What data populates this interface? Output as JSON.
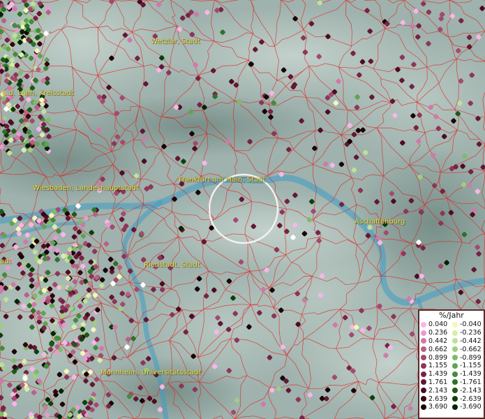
{
  "map": {
    "cities": [
      {
        "id": "wetzlar",
        "name": "Wetzlar, Stadt"
      },
      {
        "id": "lahn",
        "name": "a.d. Lahn, Kreisstadt"
      },
      {
        "id": "wiesbaden",
        "name": "Wiesbaden, Landeshauptstadt"
      },
      {
        "id": "frankfurt",
        "name": "Frankfurt am Main, Stadt"
      },
      {
        "id": "aschaffenburg",
        "name": "Aschaffenburg"
      },
      {
        "id": "riedstadt",
        "name": "Riedstadt, Stadt"
      },
      {
        "id": "mannheim",
        "name": "Mannheim, Universitätsstadt"
      },
      {
        "id": "edge",
        "name": "adt"
      }
    ],
    "colors": {
      "terrain": "#9fb2ad",
      "river": "#3e9cc4",
      "boundary": "#e02020",
      "label": "#f2e25a"
    }
  },
  "legend": {
    "title": "%/Jahr",
    "positive": [
      {
        "value": "0.040",
        "color": "#f7b6e6"
      },
      {
        "value": "0.236",
        "color": "#e79ad0"
      },
      {
        "value": "0.442",
        "color": "#cf7aa8"
      },
      {
        "value": "0.662",
        "color": "#b96087"
      },
      {
        "value": "0.899",
        "color": "#a34a6e"
      },
      {
        "value": "1.155",
        "color": "#8d3658"
      },
      {
        "value": "1.439",
        "color": "#772444"
      },
      {
        "value": "1.761",
        "color": "#621833"
      },
      {
        "value": "2.143",
        "color": "#4c0d23"
      },
      {
        "value": "2.639",
        "color": "#340613"
      },
      {
        "value": "3.690",
        "color": "#1a0208"
      }
    ],
    "negative": [
      {
        "value": "-0.040",
        "color": "#f3f7b8"
      },
      {
        "value": "-0.236",
        "color": "#d9edaa"
      },
      {
        "value": "-0.442",
        "color": "#bfe09a"
      },
      {
        "value": "-0.662",
        "color": "#9fce82"
      },
      {
        "value": "-0.899",
        "color": "#7fbb6a"
      },
      {
        "value": "-1.155",
        "color": "#5fa452"
      },
      {
        "value": "-1.439",
        "color": "#448c3c"
      },
      {
        "value": "-1.761",
        "color": "#2d722a"
      },
      {
        "value": "-2.143",
        "color": "#1b5a1b"
      },
      {
        "value": "-2.639",
        "color": "#0d3f0d"
      },
      {
        "value": "-3.690",
        "color": "#042204"
      }
    ]
  }
}
